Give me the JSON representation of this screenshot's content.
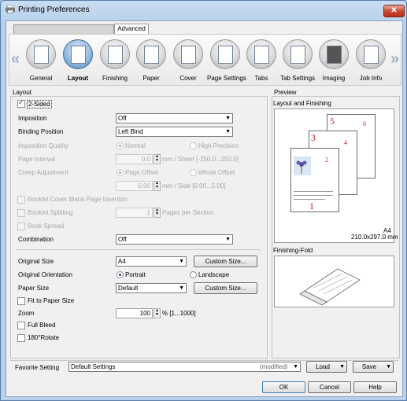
{
  "window": {
    "title": "Printing Preferences",
    "close": "✕"
  },
  "tabs": {
    "first": "",
    "advanced": "Advanced"
  },
  "iconbar": {
    "items": [
      {
        "label": "General"
      },
      {
        "label": "Layout"
      },
      {
        "label": "Finishing"
      },
      {
        "label": "Paper"
      },
      {
        "label": "Cover"
      },
      {
        "label": "Page Settings"
      },
      {
        "label": "Tabs"
      },
      {
        "label": "Tab Settings"
      },
      {
        "label": "Imaging"
      },
      {
        "label": "Job Info"
      }
    ],
    "prev": "«",
    "next": "»"
  },
  "layout": {
    "group_title": "Layout",
    "two_sided": "2-Sided",
    "imposition_label": "Imposition",
    "imposition_value": "Off",
    "binding_label": "Binding Position",
    "binding_value": "Left Bind",
    "imposition_quality_label": "Imposition Quality",
    "quality_normal": "Normal",
    "quality_high": "High Precision",
    "page_interval_label": "Page Interval",
    "page_interval_value": "0.0",
    "page_interval_unit": "mm / Sheet [-250.0...250.0]",
    "creep_label": "Creep Adjustment",
    "creep_page_offset": "Page Offset",
    "creep_whole_offset": "Whole Offset",
    "creep_value": "0.00",
    "creep_unit": "mm / Side [0.00...5.00]",
    "booklet_cover_blank": "Booklet Cover Blank Page Insertion",
    "booklet_splitting": "Booklet Splitting",
    "pages_per_section_value": "1",
    "pages_per_section_label": "Pages per Section",
    "book_spread": "Book Spread",
    "combination_label": "Combination",
    "combination_value": "Off",
    "original_size_label": "Original Size",
    "original_size_value": "A4",
    "custom_size_1": "Custom Size...",
    "orientation_label": "Original Orientation",
    "portrait": "Portrait",
    "landscape": "Landscape",
    "paper_size_label": "Paper Size",
    "paper_size_value": "Default",
    "custom_size_2": "Custom Size...",
    "fit_to_paper": "Fit to Paper Size",
    "zoom_label": "Zoom",
    "zoom_value": "100",
    "zoom_unit": "% [1...1000]",
    "full_bleed": "Full Bleed",
    "rotate_180": "180°Rotate"
  },
  "preview": {
    "group_title": "Preview",
    "section1": "Layout and Finishing",
    "paper_label": "A4",
    "paper_dims": "210.0x297.0 mm",
    "section2": "Finishing-Fold",
    "page_numbers": [
      "1",
      "2",
      "3",
      "4",
      "5",
      "6"
    ]
  },
  "footer": {
    "favorite_label": "Favorite Setting",
    "favorite_value": "Default Settings",
    "modified": "(modified)",
    "load": "Load",
    "save": "Save",
    "ok": "OK",
    "cancel": "Cancel",
    "help": "Help"
  }
}
